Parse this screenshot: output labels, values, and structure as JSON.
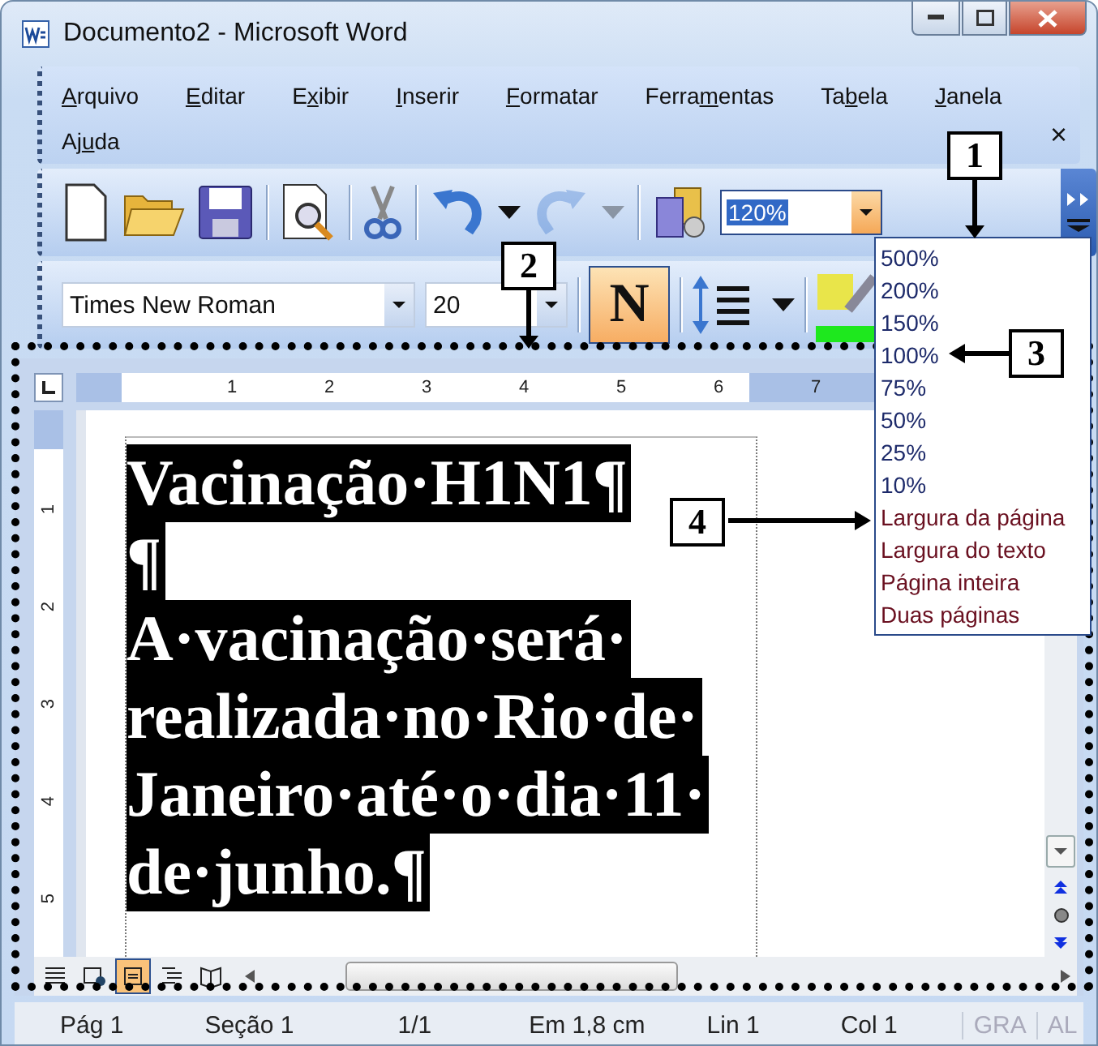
{
  "window": {
    "title": "Documento2 - Microsoft Word"
  },
  "menu": {
    "items": [
      {
        "key": "A",
        "after": "rquivo"
      },
      {
        "key": "E",
        "after": "ditar"
      },
      {
        "before": "E",
        "key": "x",
        "after": "ibir"
      },
      {
        "key": "I",
        "after": "nserir"
      },
      {
        "key": "F",
        "after": "ormatar"
      },
      {
        "before": "Ferra",
        "key": "m",
        "after": "entas"
      },
      {
        "before": "Ta",
        "key": "b",
        "after": "ela"
      },
      {
        "key": "J",
        "after": "anela"
      },
      {
        "before": "Aj",
        "key": "u",
        "after": "da"
      }
    ],
    "close": "×"
  },
  "standard_toolbar": {
    "undo_disabled": false,
    "redo_disabled": true,
    "zoom": {
      "value": "120%",
      "expanded": true,
      "options": [
        {
          "label": "500%",
          "kind": "percent"
        },
        {
          "label": "200%",
          "kind": "percent"
        },
        {
          "label": "150%",
          "kind": "percent"
        },
        {
          "label": "100%",
          "kind": "percent"
        },
        {
          "label": "75%",
          "kind": "percent"
        },
        {
          "label": "50%",
          "kind": "percent"
        },
        {
          "label": "25%",
          "kind": "percent"
        },
        {
          "label": "10%",
          "kind": "percent"
        },
        {
          "label": "Largura da página",
          "kind": "fit"
        },
        {
          "label": "Largura do texto",
          "kind": "fit"
        },
        {
          "label": "Página inteira",
          "kind": "fit"
        },
        {
          "label": "Duas páginas",
          "kind": "fit"
        }
      ]
    }
  },
  "format_toolbar": {
    "font": "Times New Roman",
    "size": "20",
    "bold": {
      "label": "N",
      "on": true
    }
  },
  "ruler": {
    "horizontal": [
      "1",
      "2",
      "3",
      "4",
      "5",
      "6",
      "7"
    ],
    "vertical": [
      "1",
      "2",
      "3",
      "4",
      "5"
    ]
  },
  "document": {
    "selected": true,
    "lines": [
      "Vacinação·H1N1¶",
      "¶",
      "A·vacinação·será·",
      "realizada·no·Rio·de·",
      "Janeiro·até·o·dia·11·",
      "de·junho.¶"
    ]
  },
  "views": [
    {
      "kind": "normal",
      "selected": false
    },
    {
      "kind": "web",
      "selected": false
    },
    {
      "kind": "print",
      "selected": true
    },
    {
      "kind": "outline",
      "selected": false
    },
    {
      "kind": "reading",
      "selected": false
    }
  ],
  "status_bar": {
    "items": [
      "Pág 1",
      "Seção 1",
      "1/1",
      "Em 1,8 cm",
      "Lin 1",
      "Col 1"
    ],
    "indicators": [
      {
        "label": "GRA",
        "on": false
      },
      {
        "label": "AL",
        "on": false
      }
    ]
  },
  "annotations": [
    {
      "label": "1"
    },
    {
      "label": "2"
    },
    {
      "label": "3"
    },
    {
      "label": "4"
    }
  ]
}
